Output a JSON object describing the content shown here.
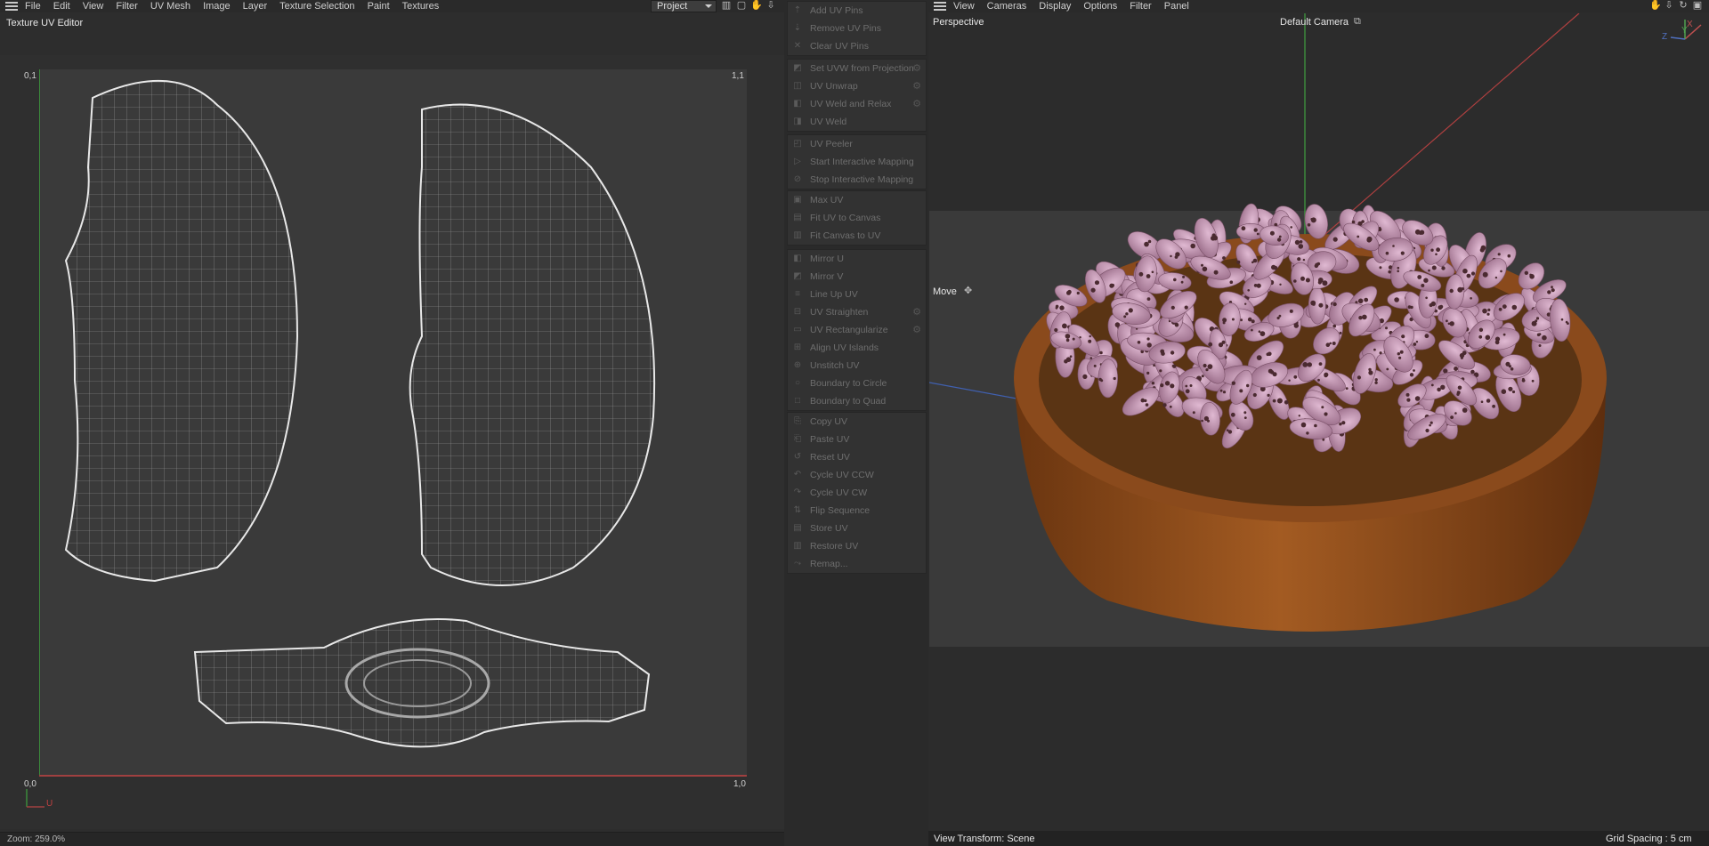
{
  "uv_editor": {
    "menu": [
      "File",
      "Edit",
      "View",
      "Filter",
      "UV Mesh",
      "Image",
      "Layer",
      "Texture Selection",
      "Paint",
      "Textures"
    ],
    "project_select": "Project",
    "title": "Texture UV Editor",
    "corner_labels": {
      "top_left": "0,1",
      "top_right": "1,1",
      "bottom_left": "0,0",
      "bottom_right": "1,0"
    },
    "axis_u": "U",
    "zoom": "Zoom: 259.0%"
  },
  "commands": {
    "groups": [
      [
        {
          "label": "Add UV Pins",
          "icon": "pin-icon"
        },
        {
          "label": "Remove UV Pins",
          "icon": "pin-remove-icon"
        },
        {
          "label": "Clear UV Pins",
          "icon": "clear-icon"
        }
      ],
      [
        {
          "label": "Set UVW from Projection",
          "icon": "projection-icon",
          "gear": true
        },
        {
          "label": "UV Unwrap",
          "icon": "unwrap-icon",
          "gear": true
        },
        {
          "label": "UV Weld and Relax",
          "icon": "weld-relax-icon",
          "gear": true
        },
        {
          "label": "UV Weld",
          "icon": "weld-icon"
        }
      ],
      [
        {
          "label": "UV Peeler",
          "icon": "peeler-icon"
        },
        {
          "label": "Start Interactive Mapping",
          "icon": "play-icon"
        },
        {
          "label": "Stop Interactive Mapping",
          "icon": "stop-icon"
        }
      ],
      [
        {
          "label": "Max UV",
          "icon": "max-icon"
        },
        {
          "label": "Fit UV to Canvas",
          "icon": "fit-icon"
        },
        {
          "label": "Fit Canvas to UV",
          "icon": "fit-canvas-icon"
        }
      ],
      [
        {
          "label": "Mirror U",
          "icon": "mirror-u-icon"
        },
        {
          "label": "Mirror V",
          "icon": "mirror-v-icon"
        },
        {
          "label": "Line Up UV",
          "icon": "lineup-icon"
        },
        {
          "label": "UV Straighten",
          "icon": "straighten-icon",
          "gear": true
        },
        {
          "label": "UV Rectangularize",
          "icon": "rectangularize-icon",
          "gear": true
        },
        {
          "label": "Align UV Islands",
          "icon": "align-icon"
        },
        {
          "label": "Unstitch UV",
          "icon": "unstitch-icon"
        },
        {
          "label": "Boundary to Circle",
          "icon": "circle-icon"
        },
        {
          "label": "Boundary to Quad",
          "icon": "quad-icon"
        }
      ],
      [
        {
          "label": "Copy UV",
          "icon": "copy-icon"
        },
        {
          "label": "Paste UV",
          "icon": "paste-icon"
        },
        {
          "label": "Reset UV",
          "icon": "reset-icon"
        },
        {
          "label": "Cycle UV CCW",
          "icon": "ccw-icon"
        },
        {
          "label": "Cycle UV CW",
          "icon": "cw-icon"
        },
        {
          "label": "Flip Sequence",
          "icon": "flip-icon"
        },
        {
          "label": "Store UV",
          "icon": "store-icon"
        },
        {
          "label": "Restore UV",
          "icon": "restore-icon"
        },
        {
          "label": "Remap...",
          "icon": "remap-icon"
        }
      ]
    ]
  },
  "viewport": {
    "menu": [
      "View",
      "Cameras",
      "Display",
      "Options",
      "Filter",
      "Panel"
    ],
    "view_name": "Perspective",
    "camera": "Default Camera",
    "tool": "Move",
    "view_transform": "View Transform: Scene",
    "grid_spacing": "Grid Spacing : 5 cm",
    "axis_labels": {
      "x": "X",
      "y": "Y",
      "z": "Z"
    }
  },
  "colors": {
    "bowl": "#8a4a1c",
    "bean": "#b98aa8",
    "spot": "#4a2a30",
    "axis_x": "#c05050",
    "axis_y": "#50a050",
    "axis_z": "#5070c0"
  }
}
